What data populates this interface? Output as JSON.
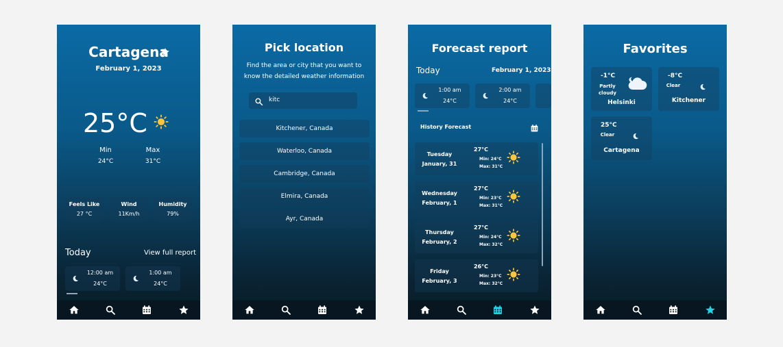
{
  "icons": {
    "home": "home-icon",
    "search": "search-icon",
    "calendar": "calendar-icon",
    "favorites": "star-icon",
    "sun": "sun-icon",
    "moon": "moon-icon",
    "cloud": "cloud-icon"
  },
  "colors": {
    "accent": "#22d3e6",
    "nav_default": "#ffffff",
    "sun": "#ffc53d"
  },
  "home": {
    "city": "Cartagena",
    "date": "February 1, 2023",
    "temperature": "25°C",
    "min_label": "Min",
    "min_value": "24°C",
    "max_label": "Max",
    "max_value": "31°C",
    "stats": [
      {
        "label": "Feels Like",
        "value": "27 °C"
      },
      {
        "label": "Wind",
        "value": "11Km/h"
      },
      {
        "label": "Humidity",
        "value": "79%"
      }
    ],
    "today_label": "Today",
    "view_full_report": "View full report",
    "hours": [
      {
        "time": "12:00 am",
        "temp": "24°C"
      },
      {
        "time": "1:00 am",
        "temp": "24°C"
      }
    ]
  },
  "search": {
    "title": "Pick location",
    "subtitle": "Find the area or city that you want to know the detailed weather information",
    "query": "kitc",
    "results": [
      "Kitchener, Canada",
      "Waterloo, Canada",
      "Cambridge, Canada",
      "Elmira, Canada",
      "Ayr, Canada"
    ]
  },
  "forecast": {
    "title": "Forecast report",
    "today_label": "Today",
    "date": "February 1, 2023",
    "hours": [
      {
        "time": "1:00 am",
        "temp": "24°C"
      },
      {
        "time": "2:00 am",
        "temp": "24°C"
      }
    ],
    "history_label": "History Forecast",
    "days": [
      {
        "day": "Tuesday",
        "date": "January, 31",
        "temp": "27°C",
        "min": "Min: 24°C",
        "max": "Max: 31°C"
      },
      {
        "day": "Wednesday",
        "date": "February, 1",
        "temp": "27°C",
        "min": "Min: 23°C",
        "max": "Max: 31°C"
      },
      {
        "day": "Thursday",
        "date": "February, 2",
        "temp": "27°C",
        "min": "Min: 24°C",
        "max": "Max: 32°C"
      },
      {
        "day": "Friday",
        "date": "February, 3",
        "temp": "26°C",
        "min": "Min: 23°C",
        "max": "Max: 32°C"
      }
    ]
  },
  "favorites": {
    "title": "Favorites",
    "items": [
      {
        "temp": "-1°C",
        "condition": "Partly cloudy",
        "city": "Helsinki"
      },
      {
        "temp": "-8°C",
        "condition": "Clear",
        "city": "Kitchener"
      },
      {
        "temp": "25°C",
        "condition": "Clear",
        "city": "Cartagena"
      }
    ]
  }
}
